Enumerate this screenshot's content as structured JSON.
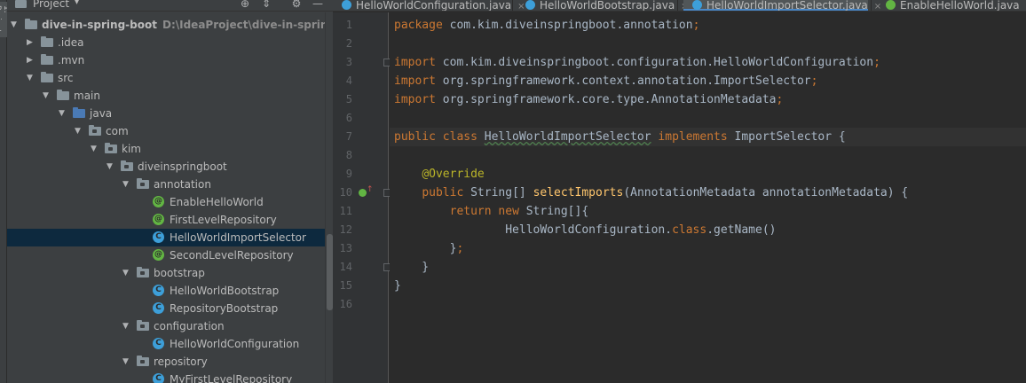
{
  "side_strip": {
    "label": "1: Project"
  },
  "project_panel": {
    "title": "Project",
    "caret": "▾",
    "tools": {
      "locate": "⊕",
      "collapse": "⇕",
      "settings": "⚙",
      "hide": "—"
    }
  },
  "tree": [
    {
      "label": "dive-in-spring-boot",
      "path": "D:\\IdeaProject\\dive-in-spring-boot",
      "type": "folder",
      "arrow": "▼"
    },
    {
      "label": ".idea",
      "type": "folder",
      "arrow": "▶"
    },
    {
      "label": ".mvn",
      "type": "folder",
      "arrow": "▶"
    },
    {
      "label": "src",
      "type": "folder",
      "arrow": "▼"
    },
    {
      "label": "main",
      "type": "folder",
      "arrow": "▼"
    },
    {
      "label": "java",
      "type": "source-folder",
      "arrow": "▼"
    },
    {
      "label": "com",
      "type": "package",
      "arrow": "▼"
    },
    {
      "label": "kim",
      "type": "package",
      "arrow": "▼"
    },
    {
      "label": "diveinspringboot",
      "type": "package",
      "arrow": "▼"
    },
    {
      "label": "annotation",
      "type": "package",
      "arrow": "▼"
    },
    {
      "label": "EnableHelloWorld",
      "type": "annotation",
      "glyph": "@"
    },
    {
      "label": "FirstLevelRepository",
      "type": "annotation",
      "glyph": "@"
    },
    {
      "label": "HelloWorldImportSelector",
      "type": "class",
      "glyph": "C",
      "selected": true
    },
    {
      "label": "SecondLevelRepository",
      "type": "annotation",
      "glyph": "@"
    },
    {
      "label": "bootstrap",
      "type": "package",
      "arrow": "▼"
    },
    {
      "label": "HelloWorldBootstrap",
      "type": "class",
      "glyph": "C"
    },
    {
      "label": "RepositoryBootstrap",
      "type": "class",
      "glyph": "C"
    },
    {
      "label": "configuration",
      "type": "package",
      "arrow": "▼"
    },
    {
      "label": "HelloWorldConfiguration",
      "type": "class",
      "glyph": "C"
    },
    {
      "label": "repository",
      "type": "package",
      "arrow": "▼"
    },
    {
      "label": "MyFirstLevelRepository",
      "type": "class",
      "glyph": "C"
    }
  ],
  "tabs": [
    {
      "label": "HelloWorldConfiguration.java",
      "icon": "class",
      "close": "×"
    },
    {
      "label": "HelloWorldBootstrap.java",
      "icon": "class",
      "close": "×"
    },
    {
      "label": "HelloWorldImportSelector.java",
      "icon": "class",
      "close": "×",
      "active": true
    },
    {
      "label": "EnableHelloWorld.java",
      "icon": "annotation",
      "close": "×"
    }
  ],
  "code": {
    "line_numbers": [
      "1",
      "2",
      "3",
      "4",
      "5",
      "6",
      "7",
      "8",
      "9",
      "10",
      "11",
      "12",
      "13",
      "14",
      "15",
      "16"
    ],
    "current_line": 7,
    "lines": [
      [
        {
          "t": "package",
          "c": "kw"
        },
        {
          "t": " com.kim.diveinspringboot.annotation"
        },
        {
          "t": ";",
          "c": "kw"
        }
      ],
      [],
      [
        {
          "t": "import",
          "c": "kw"
        },
        {
          "t": " com.kim.diveinspringboot.configuration.HelloWorldConfiguration"
        },
        {
          "t": ";",
          "c": "kw"
        }
      ],
      [
        {
          "t": "import",
          "c": "kw"
        },
        {
          "t": " org.springframework.context.annotation.ImportSelector"
        },
        {
          "t": ";",
          "c": "kw"
        }
      ],
      [
        {
          "t": "import",
          "c": "kw"
        },
        {
          "t": " org.springframework.core.type.AnnotationMetadata"
        },
        {
          "t": ";",
          "c": "kw"
        }
      ],
      [],
      [
        {
          "t": "public class ",
          "c": "kw"
        },
        {
          "t": "HelloWorldImportSelector",
          "c": "cls-hl"
        },
        {
          "t": " implements ",
          "c": "kw"
        },
        {
          "t": "ImportSelector {"
        }
      ],
      [],
      [
        {
          "t": "    "
        },
        {
          "t": "@Override",
          "c": "ann"
        }
      ],
      [
        {
          "t": "    "
        },
        {
          "t": "public ",
          "c": "kw"
        },
        {
          "t": "String[] "
        },
        {
          "t": "selectImports",
          "c": "fn"
        },
        {
          "t": "(AnnotationMetadata annotationMetadata) {"
        }
      ],
      [
        {
          "t": "        "
        },
        {
          "t": "return new ",
          "c": "kw"
        },
        {
          "t": "String[]{"
        }
      ],
      [
        {
          "t": "                HelloWorldConfiguration."
        },
        {
          "t": "class",
          "c": "kw"
        },
        {
          "t": ".getName()"
        }
      ],
      [
        {
          "t": "        }"
        },
        {
          "t": ";",
          "c": "kw"
        }
      ],
      [
        {
          "t": "    }"
        }
      ],
      [
        {
          "t": "}"
        }
      ],
      []
    ]
  },
  "colors": {
    "panel_bg": "#3c3f41",
    "editor_bg": "#2b2b2b",
    "keyword": "#cc7832",
    "annotation": "#bbb529",
    "method": "#ffc66d",
    "plain": "#a9b7c6",
    "selection": "#0d293e",
    "tab_active_underline": "#4a88c7"
  }
}
